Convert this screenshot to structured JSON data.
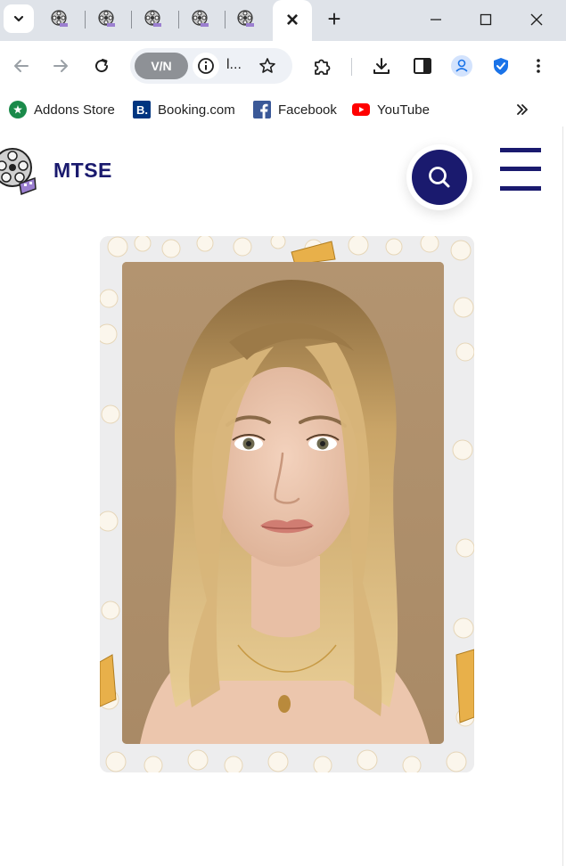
{
  "browser": {
    "active_tab_close_label": "×",
    "new_tab_label": "+",
    "vpn_label": "V/N",
    "url_text": "l..."
  },
  "bookmarks": [
    {
      "label": "Addons Store",
      "icon": "addons-store-icon",
      "color": "#1a8a4a"
    },
    {
      "label": "Booking.com",
      "icon": "booking-icon",
      "color": "#003580"
    },
    {
      "label": "Facebook",
      "icon": "facebook-icon",
      "color": "#3b5998"
    },
    {
      "label": "YouTube",
      "icon": "youtube-icon",
      "color": "#ff0000"
    }
  ],
  "site": {
    "name": "MTSE",
    "brand_color": "#1a1a6e"
  },
  "hero": {
    "image_subject": "portrait of a woman with wavy blonde hair on a popcorn background"
  }
}
